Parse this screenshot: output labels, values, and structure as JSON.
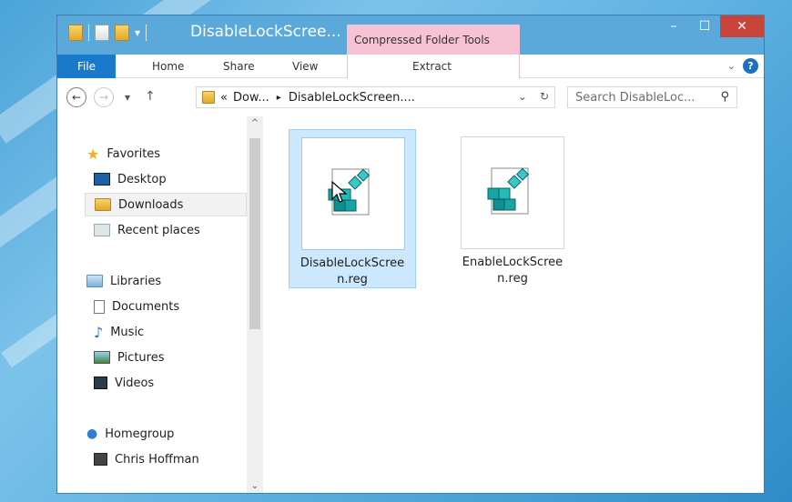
{
  "window": {
    "title": "DisableLockScree...",
    "context_tab_group": "Compressed Folder Tools",
    "controls": {
      "minimize": "–",
      "maximize": "☐",
      "close": "✕"
    }
  },
  "ribbon": {
    "tabs": [
      {
        "label": "File"
      },
      {
        "label": "Home"
      },
      {
        "label": "Share"
      },
      {
        "label": "View"
      },
      {
        "label": "Extract"
      }
    ],
    "expand_glyph": "⌄",
    "help_label": "?"
  },
  "address": {
    "back_glyph": "←",
    "forward_glyph": "→",
    "recent_glyph": "▾",
    "up_glyph": "↑",
    "path_prefix": "«",
    "crumb_1": "Dow...",
    "crumb_sep": "▸",
    "crumb_2": "DisableLockScreen....",
    "dropdown_glyph": "⌄",
    "refresh_glyph": "↻",
    "search_placeholder": "Search DisableLoc...",
    "search_glyph": "⚲"
  },
  "nav": {
    "favorites": "Favorites",
    "desktop": "Desktop",
    "downloads": "Downloads",
    "recent_places": "Recent places",
    "libraries": "Libraries",
    "documents": "Documents",
    "music": "Music",
    "pictures": "Pictures",
    "videos": "Videos",
    "homegroup": "Homegroup",
    "user": "Chris Hoffman"
  },
  "scroll": {
    "up": "^",
    "down": "⌄"
  },
  "files": [
    {
      "label": "DisableLockScree\nn.reg",
      "selected": true
    },
    {
      "label": "EnableLockScree\nn.reg",
      "selected": false
    }
  ],
  "colors": {
    "ribbon_file_tab": "#1979ca",
    "context_tab": "#f7c2d4",
    "close_button": "#c7453a",
    "selection": "#cce8ff"
  }
}
